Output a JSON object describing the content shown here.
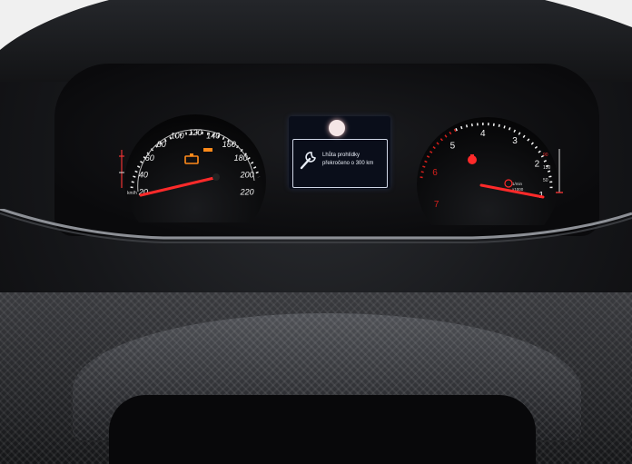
{
  "speedometer": {
    "labels": [
      "20",
      "40",
      "60",
      "80",
      "100",
      "120",
      "140",
      "160",
      "180",
      "200",
      "220"
    ],
    "inner_ticks": [
      "20",
      "10",
      "100"
    ],
    "unit": "km/h",
    "needle_color": "#ff2a2a"
  },
  "tachometer": {
    "labels": [
      "1",
      "2",
      "3",
      "4",
      "5",
      "6",
      "7"
    ],
    "unit_lines": [
      "1/min",
      "x1000"
    ],
    "inner_ticks": [
      "90",
      "130",
      "50"
    ],
    "redline_color": "#d8201c"
  },
  "center_display": {
    "message_line1": "Lhůta prohlídky",
    "message_line2": "překročeno o 300 km",
    "icon": "wrench-icon",
    "indicator": "service-indicator-light"
  },
  "warning_lights": {
    "engine_check_color": "#ff8a1a",
    "red_warning_color": "#ff2a2a"
  }
}
